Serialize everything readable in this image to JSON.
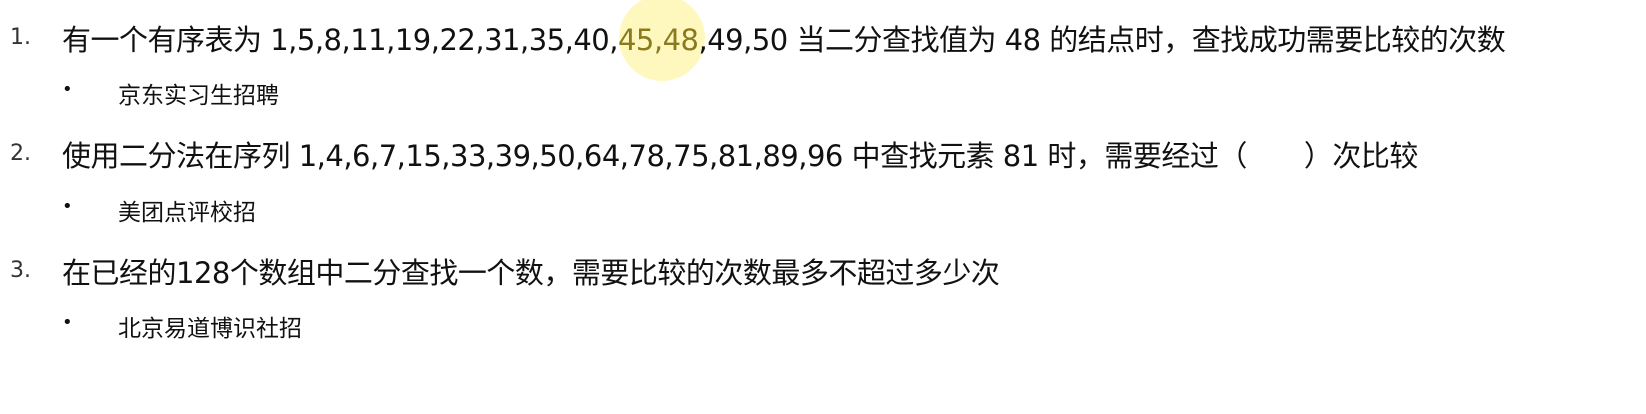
{
  "questions": [
    {
      "number": "1.",
      "text_before": "有一个有序表为 1,5,8,11,19,22,31,35,40,",
      "highlight_1": "45",
      "separator": ",",
      "highlight_2": "48",
      "text_after": ",49,50 当二分查找值为 48 的结点时，查找成功需要比较的次数",
      "source": "京东实习生招聘"
    },
    {
      "number": "2.",
      "text": "使用二分法在序列 1,4,6,7,15,33,39,50,64,78,75,81,89,96 中查找元素 81 时，需要经过（　　）次比较",
      "source": "美团点评校招"
    },
    {
      "number": "3.",
      "text": "在已经的128个数组中二分查找一个数，需要比较的次数最多不超过多少次",
      "source": "北京易道博识社招"
    }
  ],
  "bullet_glyph": "•",
  "colors": {
    "text": "#111111",
    "highlight_text": "#8a7a1e",
    "cursor_highlight": "#fff06e"
  }
}
